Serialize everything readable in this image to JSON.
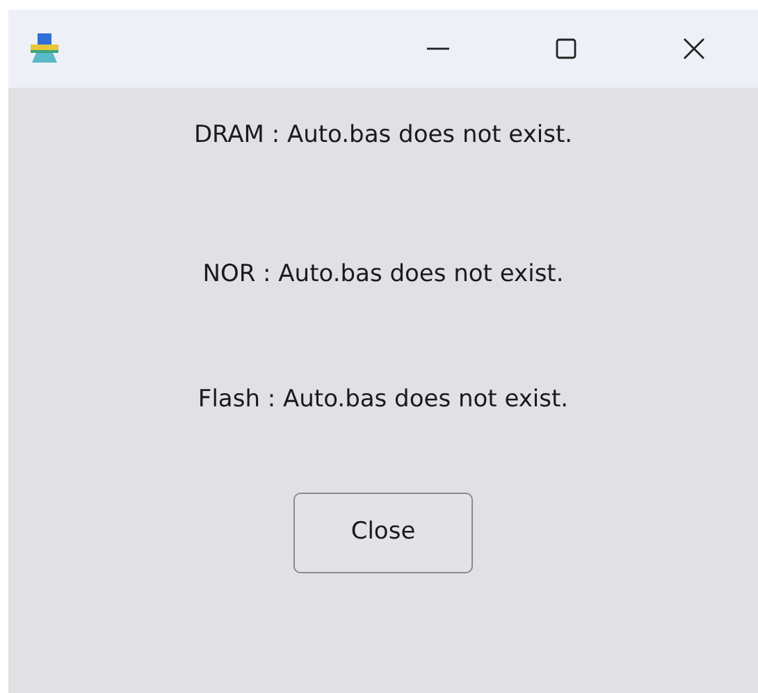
{
  "title_bar": {
    "buttons": [
      {
        "kind": "minimize"
      },
      {
        "kind": "maximize"
      },
      {
        "kind": "close"
      }
    ]
  },
  "messages": [
    "DRAM : Auto.bas does not exist.",
    "NOR : Auto.bas does not exist.",
    "Flash : Auto.bas does not exist."
  ],
  "close_button": {
    "label": "Close"
  }
}
